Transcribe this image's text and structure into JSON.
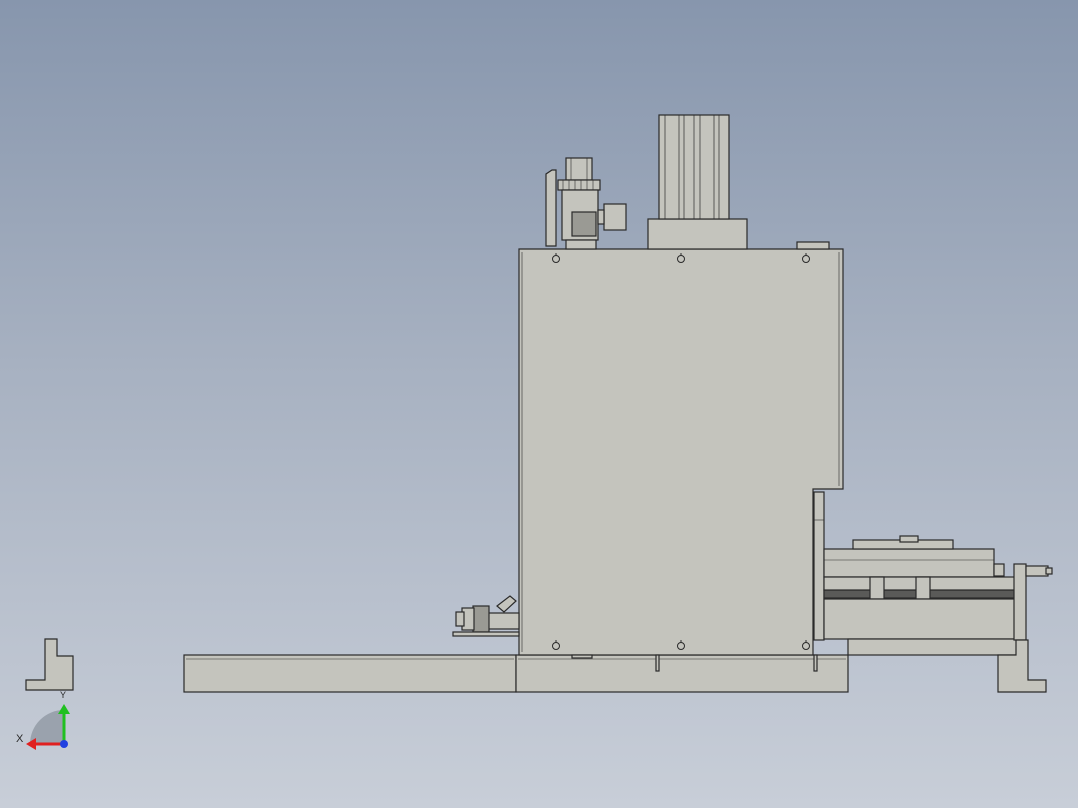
{
  "viewport": {
    "background_top": "#8796ad",
    "background_bottom": "#c8ced8",
    "part_fill": "#c4c4bd",
    "part_stroke": "#2a2a2a"
  },
  "triad": {
    "x_label": "X",
    "y_label": "Y",
    "x_color": "#e02020",
    "y_color": "#20c020",
    "z_color": "#2040e0"
  }
}
